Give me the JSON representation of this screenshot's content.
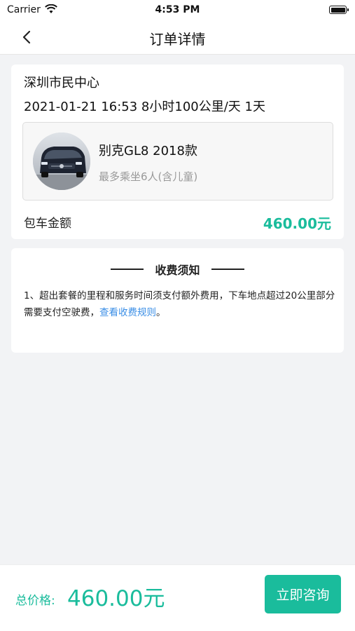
{
  "status_bar": {
    "carrier": "Carrier",
    "time": "4:53 PM"
  },
  "nav": {
    "title": "订单详情"
  },
  "order": {
    "location": "深圳市民中心",
    "detail": "2021-01-21 16:53 8小时100公里/天 1天",
    "car": {
      "name": "别克GL8 2018款",
      "seats": "最多乘坐6人(含儿童)"
    },
    "amount_label": "包车金额",
    "amount_value": "460.00元"
  },
  "notice": {
    "title": "收费须知",
    "body": "1、超出套餐的里程和服务时间须支付额外费用，下车地点超过20公里部分需要支付空驶费，",
    "link": "查看收费规则",
    "end": "。"
  },
  "bottom": {
    "total_label": "总价格:",
    "total_value": "460.00元",
    "consult_button": "立即咨询"
  },
  "colors": {
    "accent": "#1abc9c",
    "link": "#3a8ee6",
    "background": "#f2f3f5"
  }
}
